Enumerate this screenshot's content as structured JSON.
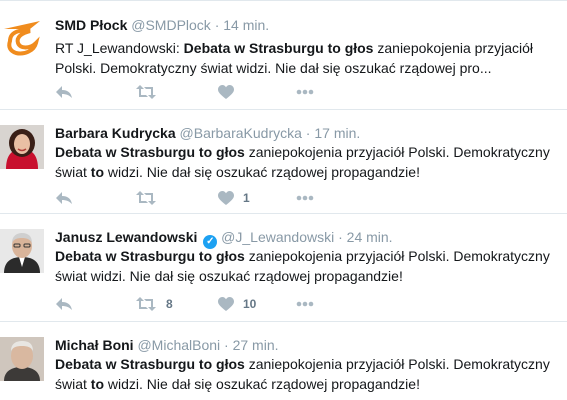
{
  "tweets": [
    {
      "name": "SMD Płock",
      "handle": "@SMDPlock",
      "sep": "·",
      "time": "14 min.",
      "verified": false,
      "text": {
        "prefix": "RT J_Lewandowski: ",
        "bold": "Debata w Strasburgu to głos",
        "rest": " zaniepokojenia przyjaciół Polski. Demokratyczny świat widzi. Nie dał się oszukać rządowej pro..."
      },
      "retweets": "",
      "likes": ""
    },
    {
      "name": "Barbara Kudrycka",
      "handle": "@BarbaraKudrycka",
      "sep": "·",
      "time": "17 min.",
      "verified": false,
      "text": {
        "bold": "Debata w Strasburgu to głos",
        "rest1": " zaniepokojenia przyjaciół Polski. Demokratyczny świat ",
        "bold2": "to",
        "rest2": " widzi. Nie dał się oszukać rządowej propagandzie!"
      },
      "retweets": "",
      "likes": "1"
    },
    {
      "name": "Janusz Lewandowski",
      "handle": "@J_Lewandowski",
      "sep": "·",
      "time": "24 min.",
      "verified": true,
      "text": {
        "bold": "Debata w Strasburgu to głos",
        "rest": " zaniepokojenia przyjaciół Polski. Demokratyczny świat widzi. Nie dał się oszukać rządowej propagandzie!"
      },
      "retweets": "8",
      "likes": "10"
    },
    {
      "name": "Michał Boni",
      "handle": "@MichalBoni",
      "sep": "·",
      "time": "27 min.",
      "verified": false,
      "text": {
        "bold": "Debata w Strasburgu to głos",
        "rest1": " zaniepokojenia przyjaciół Polski. Demokratyczny świat ",
        "bold2": "to",
        "rest2": " widzi. Nie dał się oszukać rządowej propagandzie!"
      },
      "retweets": "",
      "likes": ""
    }
  ],
  "icons": {
    "reply": "reply-icon",
    "retweet": "retweet-icon",
    "like": "heart-icon",
    "more": "more-icon",
    "verified": "verified-badge-icon"
  },
  "colors": {
    "brand_orange": "#f08c1e",
    "verified_blue": "#1da1f2",
    "muted": "#8899a6",
    "action_grey": "#aab8c2"
  }
}
